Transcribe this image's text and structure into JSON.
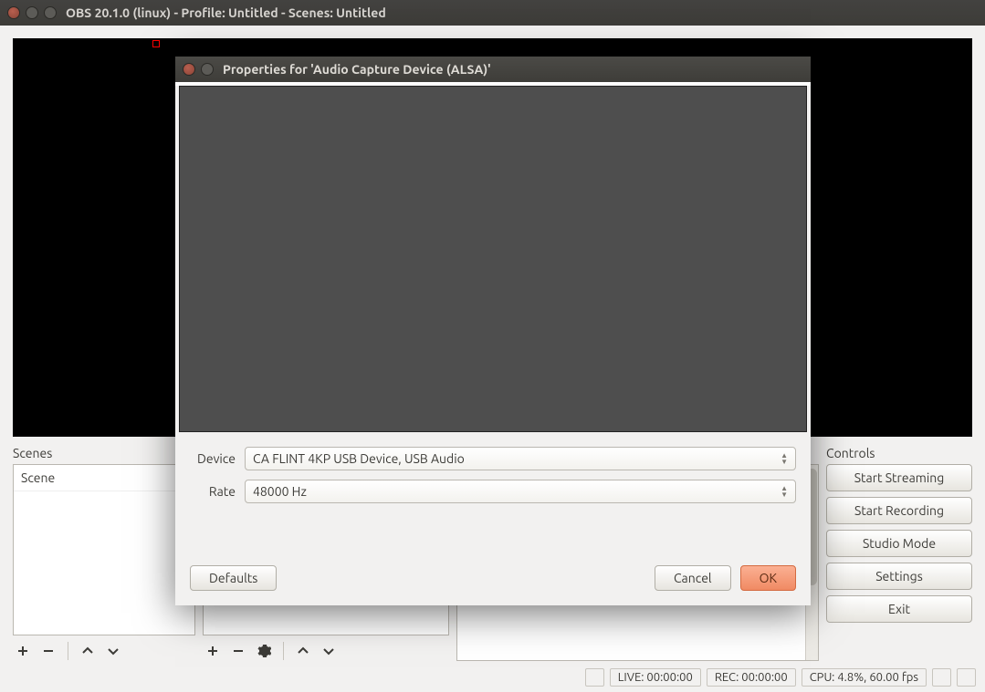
{
  "window": {
    "title": "OBS 20.1.0 (linux) - Profile: Untitled - Scenes: Untitled"
  },
  "panels": {
    "scenes": {
      "header": "Scenes",
      "items": [
        "Scene"
      ]
    },
    "controls": {
      "header": "Controls",
      "buttons": {
        "start_streaming": "Start Streaming",
        "start_recording": "Start Recording",
        "studio_mode": "Studio Mode",
        "settings": "Settings",
        "exit": "Exit"
      }
    }
  },
  "status": {
    "live": "LIVE: 00:00:00",
    "rec": "REC: 00:00:00",
    "cpu": "CPU: 4.8%, 60.00 fps"
  },
  "dialog": {
    "title": "Properties for 'Audio Capture Device (ALSA)'",
    "fields": {
      "device_label": "Device",
      "device_value": "CA FLINT 4KP USB Device, USB Audio",
      "rate_label": "Rate",
      "rate_value": "48000 Hz"
    },
    "buttons": {
      "defaults": "Defaults",
      "cancel": "Cancel",
      "ok": "OK"
    }
  }
}
